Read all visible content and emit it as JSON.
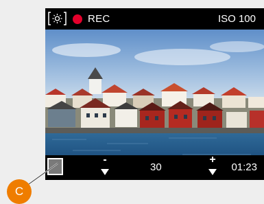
{
  "topbar": {
    "white_balance_icon": "sun-icon",
    "rec_label": "REC",
    "iso_label": "ISO 100"
  },
  "viewfinder": {
    "scene": "harbour-houses"
  },
  "bottombar": {
    "minus_symbol": "-",
    "value": "30",
    "plus_symbol": "+",
    "time": "01:23"
  },
  "callout": {
    "label": "C"
  },
  "colors": {
    "rec": "#e4002b",
    "callout": "#ef7d00"
  }
}
